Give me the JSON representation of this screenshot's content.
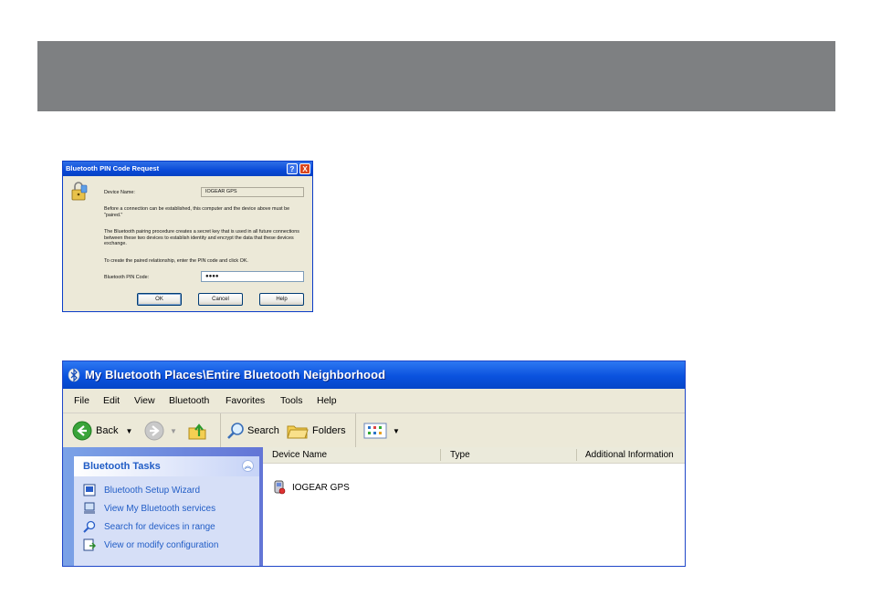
{
  "pin_dialog": {
    "title": "Bluetooth PIN Code Request",
    "title_buttons": {
      "help": "?",
      "close": "X"
    },
    "device_name_label": "Device Name:",
    "device_name_value": "IOGEAR GPS",
    "para1": "Before a connection can be established, this computer and the device above must be \"paired.\"",
    "para2": "The Bluetooth pairing procedure creates a secret key that is used in all future connections between these two devices to establish identity and encrypt the data that these devices exchange.",
    "para3": "To create the paired relationship, enter the PIN code and click OK.",
    "pin_label": "Bluetooth PIN Code:",
    "pin_value": "●●●●",
    "ok": "OK",
    "cancel": "Cancel",
    "help": "Help"
  },
  "explorer": {
    "title": "My Bluetooth Places\\Entire Bluetooth Neighborhood",
    "menu": [
      "File",
      "Edit",
      "View",
      "Bluetooth",
      "Favorites",
      "Tools",
      "Help"
    ],
    "toolbar": {
      "back": "Back",
      "search": "Search",
      "folders": "Folders"
    },
    "tasks": {
      "heading": "Bluetooth Tasks",
      "items": [
        "Bluetooth Setup Wizard",
        "View My Bluetooth services",
        "Search for devices in range",
        "View or modify configuration"
      ]
    },
    "columns": [
      "Device Name",
      "Type",
      "Additional Information"
    ],
    "devices": [
      "IOGEAR GPS"
    ]
  }
}
